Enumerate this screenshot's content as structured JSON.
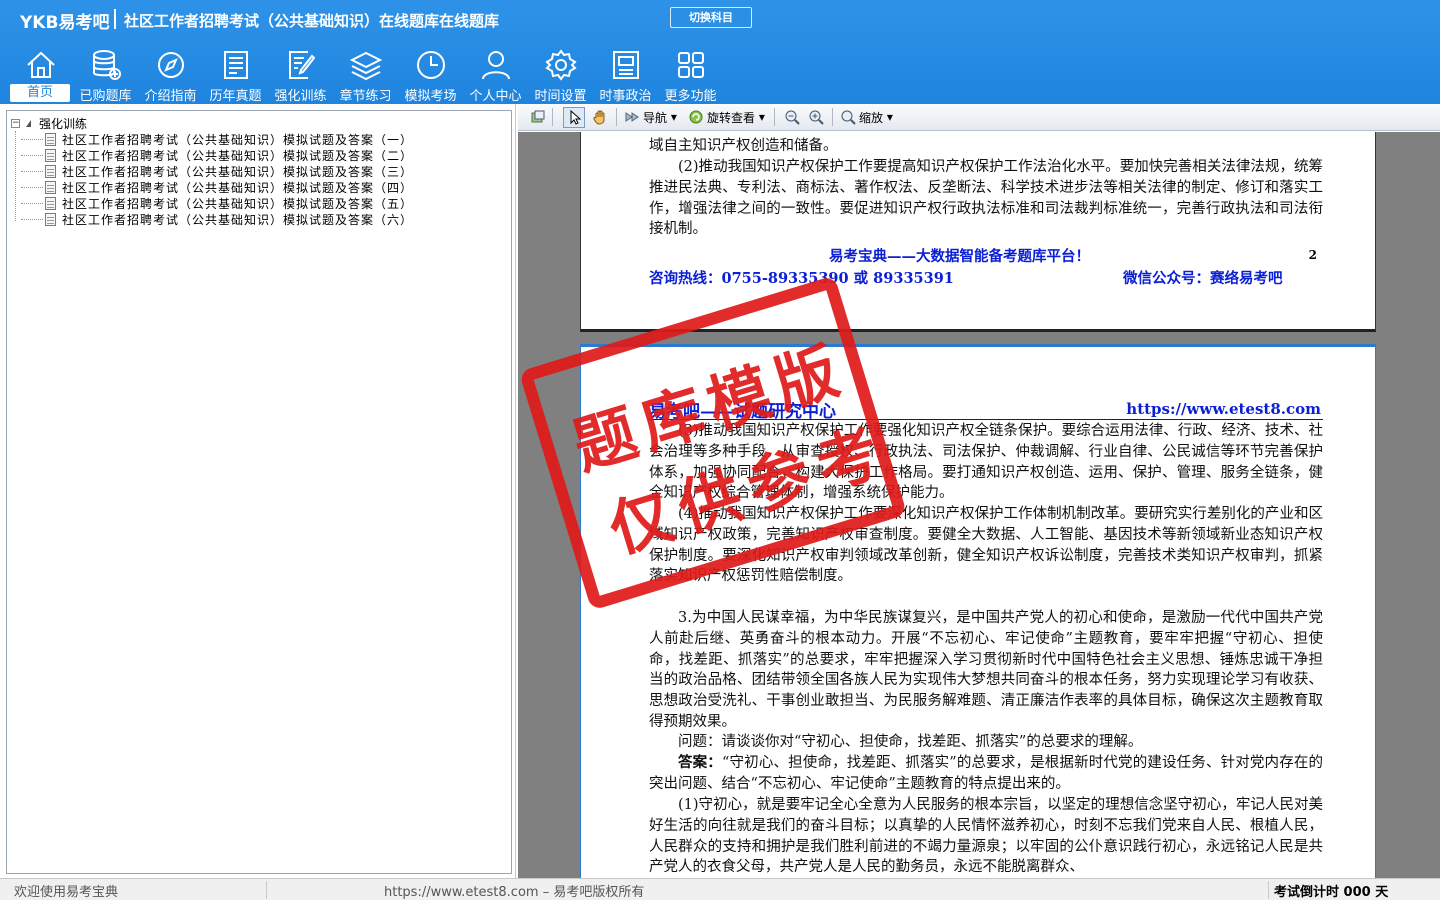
{
  "header": {
    "brand": "YKB易考吧",
    "app_title": "社区工作者招聘考试（公共基础知识）在线题库在线题库",
    "switch_label": "切换科目"
  },
  "nav": [
    {
      "label": "首页",
      "icon": "home-icon",
      "active": true
    },
    {
      "label": "已购题库",
      "icon": "database-icon"
    },
    {
      "label": "介绍指南",
      "icon": "compass-icon"
    },
    {
      "label": "历年真题",
      "icon": "document-list-icon"
    },
    {
      "label": "强化训练",
      "icon": "edit-note-icon"
    },
    {
      "label": "章节练习",
      "icon": "layers-icon"
    },
    {
      "label": "模拟考场",
      "icon": "clock-icon"
    },
    {
      "label": "个人中心",
      "icon": "user-icon"
    },
    {
      "label": "时间设置",
      "icon": "gear-icon"
    },
    {
      "label": "时事政治",
      "icon": "newspaper-icon"
    },
    {
      "label": "更多功能",
      "icon": "grid-icon"
    }
  ],
  "tree": {
    "root": "强化训练",
    "items": [
      "社区工作者招聘考试（公共基础知识）模拟试题及答案（一）",
      "社区工作者招聘考试（公共基础知识）模拟试题及答案（二）",
      "社区工作者招聘考试（公共基础知识）模拟试题及答案（三）",
      "社区工作者招聘考试（公共基础知识）模拟试题及答案（四）",
      "社区工作者招聘考试（公共基础知识）模拟试题及答案（五）",
      "社区工作者招聘考试（公共基础知识）模拟试题及答案（六）"
    ]
  },
  "toolbar": {
    "nav_label": "导航",
    "rotate_label": "旋转查看",
    "zoom_label": "缩放"
  },
  "page1": {
    "line0": "域自主知识产权创造和储备。",
    "para1": "(2)推动我国知识产权保护工作要提高知识产权保护工作法治化水平。要加快完善相关法律法规，统筹推进民法典、专利法、商标法、著作权法、反垄断法、科学技术进步法等相关法律的制定、修订和落实工作，增强法律之间的一致性。要促进知识产权行政执法标准和司法裁判标准统一，完善行政执法和司法衔接机制。",
    "footer_slogan": "易考宝典——大数据智能备考题库平台！",
    "page_number": "2",
    "hotline": "咨询热线：0755-89335390 或 89335391",
    "wechat": "微信公众号：赛络易考吧"
  },
  "page2": {
    "header_left": "易考吧——试题研究中心",
    "header_right": "https://www.etest8.com",
    "para1": "(3)推动我国知识产权保护工作要强化知识产权全链条保护。要综合运用法律、行政、经济、技术、社会治理等多种手段，从审查授权、行政执法、司法保护、仲裁调解、行业自律、公民诚信等环节完善保护体系，加强协同配合，构建大保护工作格局。要打通知识产权创造、运用、保护、管理、服务全链条，健全知识产权综合管理体制，增强系统保护能力。",
    "para2": "(4)推动我国知识产权保护工作要深化知识产权保护工作体制机制改革。要研究实行差别化的产业和区域知识产权政策，完善知识产权审查制度。要健全大数据、人工智能、基因技术等新领域新业态知识产权保护制度。要深化知识产权审判领域改革创新，健全知识产权诉讼制度，完善技术类知识产权审判，抓紧落实知识产权惩罚性赔偿制度。",
    "para3": "3.为中国人民谋幸福，为中华民族谋复兴，是中国共产党人的初心和使命，是激励一代代中国共产党人前赴后继、英勇奋斗的根本动力。开展“不忘初心、牢记使命”主题教育，要牢牢把握“守初心、担使命，找差距、抓落实”的总要求，牢牢把握深入学习贯彻新时代中国特色社会主义思想、锤炼忠诚干净担当的政治品格、团结带领全国各族人民为实现伟大梦想共同奋斗的根本任务，努力实现理论学习有收获、思想政治受洗礼、干事创业敢担当、为民服务解难题、清正廉洁作表率的具体目标，确保这次主题教育取得预期效果。",
    "question": "问题：请谈谈你对“守初心、担使命，找差距、抓落实”的总要求的理解。",
    "answer_label": "答案：",
    "answer": "“守初心、担使命，找差距、抓落实”的总要求，是根据新时代党的建设任务、针对党内存在的突出问题、结合“不忘初心、牢记使命”主题教育的特点提出来的。",
    "para4": "(1)守初心，就是要牢记全心全意为人民服务的根本宗旨，以坚定的理想信念坚守初心，牢记人民对美好生活的向往就是我们的奋斗目标；以真挚的人民情怀滋养初心，时刻不忘我们党来自人民、根植人民，人民群众的支持和拥护是我们胜利前进的不竭力量源泉；以牢固的公仆意识践行初心，永远铭记人民是共产党人的衣食父母，共产党人是人民的勤务员，永远不能脱离群众、"
  },
  "stamp": {
    "line1": "题库模版",
    "line2": "仅供参考"
  },
  "status": {
    "welcome": "欢迎使用易考宝典",
    "copyright": "https://www.etest8.com – 易考吧版权所有",
    "countdown": "考试倒计时 000 天"
  },
  "colors": {
    "header_bg": "#1f84de",
    "stamp_red": "#e01a1a",
    "footer_blue": "#0b1fd4"
  }
}
